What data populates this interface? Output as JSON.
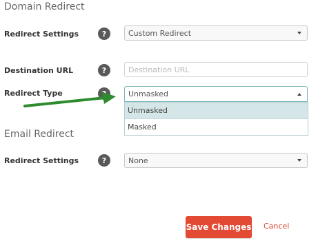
{
  "domain_redirect": {
    "title": "Domain Redirect",
    "redirect_settings": {
      "label": "Redirect Settings",
      "value": "Custom Redirect"
    },
    "destination_url": {
      "label": "Destination URL",
      "placeholder": "Destination URL"
    },
    "redirect_type": {
      "label": "Redirect Type",
      "value": "Unmasked",
      "options": [
        "Unmasked",
        "Masked"
      ]
    }
  },
  "email_redirect": {
    "title": "Email Redirect",
    "redirect_settings": {
      "label": "Redirect Settings",
      "value": "None"
    }
  },
  "help_glyph": "?",
  "actions": {
    "save_label": "Save Changes",
    "cancel_label": "Cancel"
  },
  "colors": {
    "save_button": "#e24a33",
    "cancel_link": "#d9442f",
    "annotation_arrow": "#2e8b2e",
    "selected_option": "#d5e6e8"
  },
  "icons": {
    "help": "question-icon",
    "dropdown": "chevron-down-icon",
    "annotation": "arrow-right-icon"
  }
}
